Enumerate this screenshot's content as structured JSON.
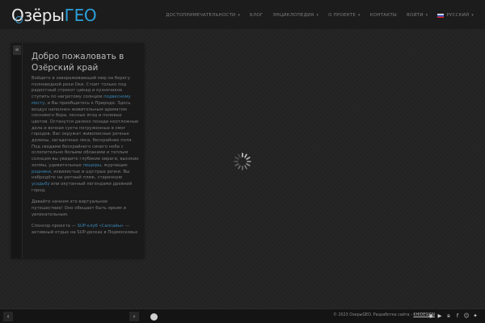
{
  "logo": {
    "part_a": "Озёры",
    "part_b": "ГЕО"
  },
  "nav": {
    "items": [
      {
        "label": "Достопримечательности",
        "has_caret": true
      },
      {
        "label": "Блог",
        "has_caret": false
      },
      {
        "label": "Энциклопедия",
        "has_caret": true
      },
      {
        "label": "О проекте",
        "has_caret": true
      },
      {
        "label": "Контакты",
        "has_caret": false
      },
      {
        "label": "Войти",
        "has_caret": true
      },
      {
        "label": "Русский",
        "has_caret": true,
        "flag": "ru"
      }
    ]
  },
  "panel": {
    "title": "Добро пожаловать в Озёрский край",
    "p1_a": "Войдите в завораживающий мир на берегу полноводной реки Оки. Стоит только под радостный стрекот цикад и кузнечиков ступить по нагретому солнцем ",
    "p1_link1": "подвесному мосту",
    "p1_b": ", и Вы приобщитесь к Природе. Здесь воздух наполнен живительным ароматом соснового бора, лесных ягод и полевых цветов. Останутся далеко позади неотложные дела и вечная суета погруженных в смог городов. Вас окружат живописные речные долины, загадочные леса, бескрайние поля. Под сводами бескрайнего синего неба с ослепительно белыми облаками и теплым солнцем вы увидите глубокие овраги, высокие холмы, удивительные ",
    "p1_link2": "пещеры",
    "p1_c": ", журчащие ",
    "p1_link3": "родники",
    "p1_d": ", извилистые и шустрые речки. Вы набредёте на уютный пляж, старинную ",
    "p1_link4": "усадьбу",
    "p1_e": " или окутанный легендами древний город.",
    "p2": "Давайте начнем это виртуальное путешествие! Оно обещает быть ярким и увлекательным.",
    "p3_a": "Спонсор проекта — ",
    "p3_link": "SUP-клуб «Сапсайы»",
    "p3_b": " — активный отдых на SUP-досках в Подмосковье"
  },
  "footer": {
    "copyright": "© 2023 ОзерыGEO. Разработка сайта - ",
    "developer": "KHIDESIGN"
  },
  "colors": {
    "accent": "#2b9fd9",
    "background": "#222222"
  }
}
